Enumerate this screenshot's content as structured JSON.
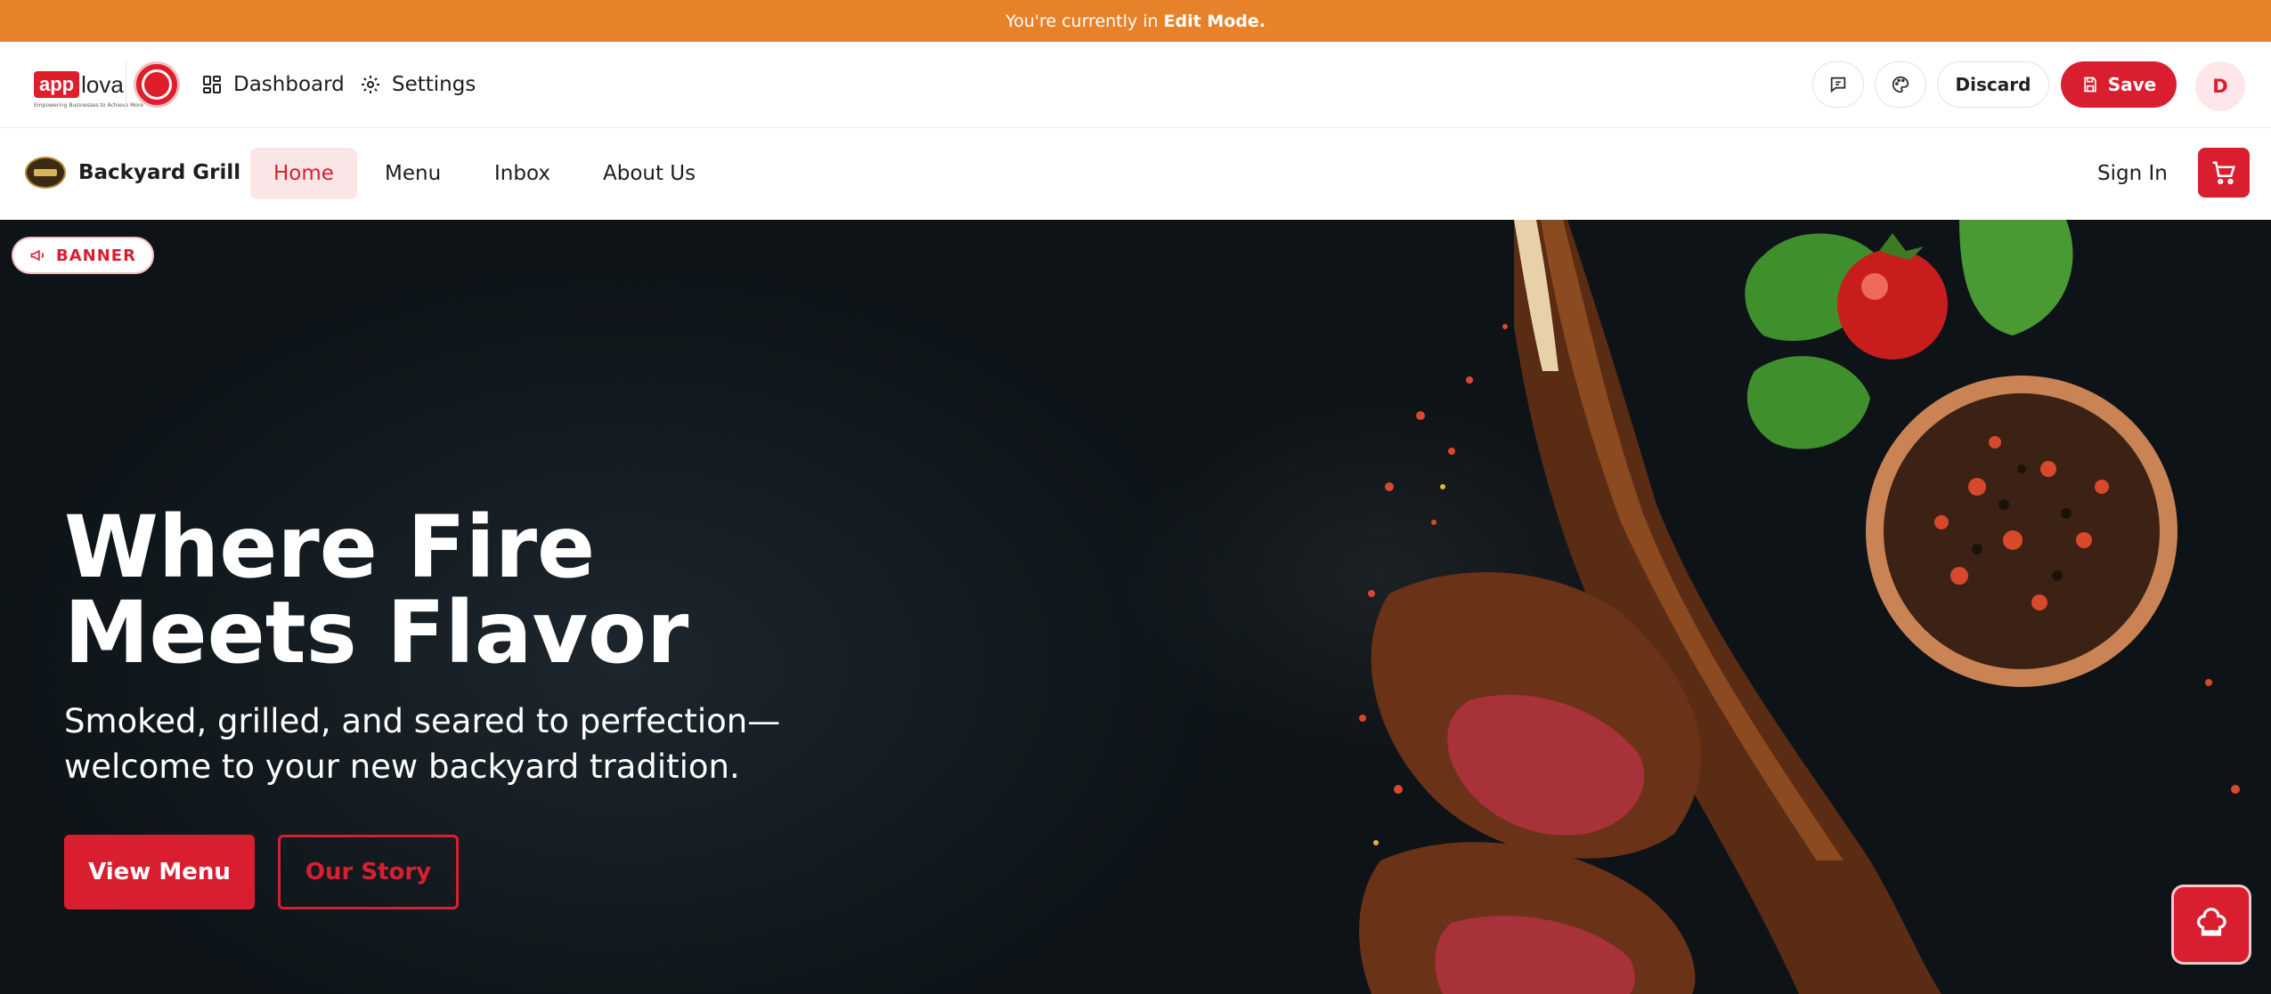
{
  "edit_banner": {
    "prefix": "You're currently in",
    "mode": "Edit Mode."
  },
  "admin": {
    "logo_text_box": "app",
    "logo_text_rest": "lova",
    "logo_tagline": "Empowering Businesses to Achieve More",
    "dashboard_label": "Dashboard",
    "settings_label": "Settings",
    "discard_label": "Discard",
    "save_label": "Save",
    "avatar_initial": "D"
  },
  "site": {
    "brand_name": "Backyard Grill",
    "nav": [
      {
        "label": "Home",
        "active": true
      },
      {
        "label": "Menu",
        "active": false
      },
      {
        "label": "Inbox",
        "active": false
      },
      {
        "label": "About Us",
        "active": false
      }
    ],
    "sign_in_label": "Sign In"
  },
  "hero": {
    "tag_label": "BANNER",
    "title_line1": "Where Fire",
    "title_line2": "Meets Flavor",
    "subtitle_line1": "Smoked, grilled, and seared to perfection—",
    "subtitle_line2": "welcome to your new backyard tradition.",
    "primary_button": "View Menu",
    "secondary_button": "Our Story"
  },
  "colors": {
    "edit_strip": "#e8822a",
    "brand_red": "#d91f2f",
    "hero_bg": "#0d1317"
  },
  "icons": [
    "dashboard-icon",
    "gear-icon",
    "feedback-icon",
    "palette-icon",
    "save-icon",
    "cart-icon",
    "megaphone-icon",
    "chef-hat-icon"
  ]
}
